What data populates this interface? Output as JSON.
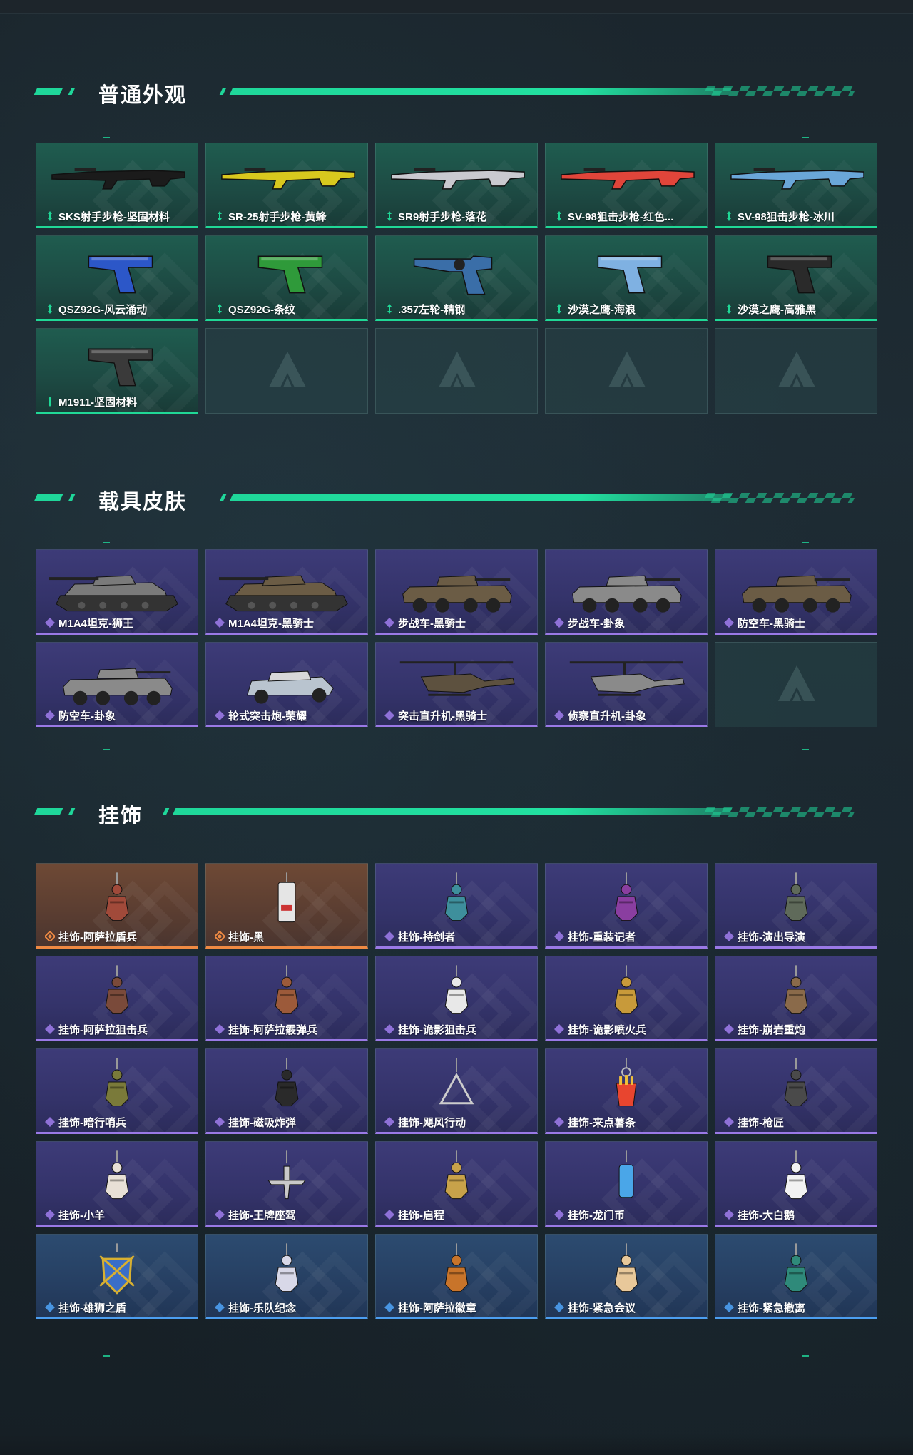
{
  "sections": {
    "skins": {
      "title": "普通外观",
      "items": [
        {
          "name": "SKS射手步枪-坚固材料",
          "rarity": "green",
          "icon": "rifle-icon",
          "color": "#1b1b1b"
        },
        {
          "name": "SR-25射手步枪-黄蜂",
          "rarity": "green",
          "icon": "rifle-icon",
          "color": "#d8c81e"
        },
        {
          "name": "SR9射手步枪-落花",
          "rarity": "green",
          "icon": "rifle-icon",
          "color": "#c9c9cf"
        },
        {
          "name": "SV-98狙击步枪-红色...",
          "rarity": "green",
          "icon": "rifle-icon",
          "color": "#e0453a"
        },
        {
          "name": "SV-98狙击步枪-冰川",
          "rarity": "green",
          "icon": "rifle-icon",
          "color": "#6aa6d8"
        },
        {
          "name": "QSZ92G-风云涌动",
          "rarity": "green",
          "icon": "pistol-icon",
          "color": "#2c57c8"
        },
        {
          "name": "QSZ92G-条纹",
          "rarity": "green",
          "icon": "pistol-icon",
          "color": "#2f9a3a"
        },
        {
          "name": ".357左轮-精钢",
          "rarity": "green",
          "icon": "revolver-icon",
          "color": "#3a6ea8"
        },
        {
          "name": "沙漠之鹰-海浪",
          "rarity": "green",
          "icon": "pistol-icon",
          "color": "#7fb1e2"
        },
        {
          "name": "沙漠之鹰-高雅黑",
          "rarity": "green",
          "icon": "pistol-icon",
          "color": "#2a2a2a"
        },
        {
          "name": "M1911-坚固材料",
          "rarity": "green",
          "icon": "pistol-icon",
          "color": "#3a3a3a"
        }
      ],
      "empty_slots": 4
    },
    "vehicles": {
      "title": "载具皮肤",
      "items": [
        {
          "name": "M1A4坦克-狮王",
          "rarity": "purple",
          "icon": "tank-icon",
          "color": "#7a7a7a"
        },
        {
          "name": "M1A4坦克-黑骑士",
          "rarity": "purple",
          "icon": "tank-icon",
          "color": "#6b5c45"
        },
        {
          "name": "步战车-黑骑士",
          "rarity": "purple",
          "icon": "apc-icon",
          "color": "#6b5c45"
        },
        {
          "name": "步战车-卦象",
          "rarity": "purple",
          "icon": "apc-icon",
          "color": "#8a8a8a"
        },
        {
          "name": "防空车-黑骑士",
          "rarity": "purple",
          "icon": "apc-icon",
          "color": "#6b5c45"
        },
        {
          "name": "防空车-卦象",
          "rarity": "purple",
          "icon": "apc-icon",
          "color": "#8a8a8a"
        },
        {
          "name": "轮式突击炮-荣耀",
          "rarity": "purple",
          "icon": "buggy-icon",
          "color": "#b9c4cf"
        },
        {
          "name": "突击直升机-黑骑士",
          "rarity": "purple",
          "icon": "helicopter-icon",
          "color": "#5d513f"
        },
        {
          "name": "侦察直升机-卦象",
          "rarity": "purple",
          "icon": "helicopter-icon",
          "color": "#8a8a8a"
        }
      ],
      "empty_slots": 1
    },
    "charms": {
      "title": "挂饰",
      "items": [
        {
          "name": "挂饰-阿萨拉盾兵",
          "rarity": "orange",
          "icon": "charm-figure-icon",
          "color": "#a14a3a"
        },
        {
          "name": "挂饰-黑",
          "rarity": "orange",
          "icon": "charm-tag-icon",
          "color": "#e5e5e5"
        },
        {
          "name": "挂饰-持剑者",
          "rarity": "purple",
          "icon": "charm-figure-icon",
          "color": "#3e8f9c"
        },
        {
          "name": "挂饰-重装记者",
          "rarity": "purple",
          "icon": "charm-figure-icon",
          "color": "#8a3ea0"
        },
        {
          "name": "挂饰-演出导演",
          "rarity": "purple",
          "icon": "charm-figure-icon",
          "color": "#5f6a5a"
        },
        {
          "name": "挂饰-阿萨拉狙击兵",
          "rarity": "purple",
          "icon": "charm-figure-icon",
          "color": "#7a4a3a"
        },
        {
          "name": "挂饰-阿萨拉霰弹兵",
          "rarity": "purple",
          "icon": "charm-figure-icon",
          "color": "#9c5a3a"
        },
        {
          "name": "挂饰-诡影狙击兵",
          "rarity": "purple",
          "icon": "charm-figure-icon",
          "color": "#e8e8e8"
        },
        {
          "name": "挂饰-诡影喷火兵",
          "rarity": "purple",
          "icon": "charm-figure-icon",
          "color": "#c89a3a"
        },
        {
          "name": "挂饰-崩岩重炮",
          "rarity": "purple",
          "icon": "charm-figure-icon",
          "color": "#8a6a4a"
        },
        {
          "name": "挂饰-暗行哨兵",
          "rarity": "purple",
          "icon": "charm-figure-icon",
          "color": "#7a7a3a"
        },
        {
          "name": "挂饰-磁吸炸弹",
          "rarity": "purple",
          "icon": "charm-bomb-icon",
          "color": "#2a2a2a"
        },
        {
          "name": "挂饰-飓风行动",
          "rarity": "purple",
          "icon": "charm-triangle-icon",
          "color": "#3a3a3a"
        },
        {
          "name": "挂饰-来点薯条",
          "rarity": "purple",
          "icon": "charm-fries-icon",
          "color": "#e8452f"
        },
        {
          "name": "挂饰-枪匠",
          "rarity": "purple",
          "icon": "charm-box-icon",
          "color": "#4a4a4a"
        },
        {
          "name": "挂饰-小羊",
          "rarity": "purple",
          "icon": "charm-sheep-icon",
          "color": "#e8e0d6"
        },
        {
          "name": "挂饰-王牌座驾",
          "rarity": "purple",
          "icon": "charm-plane-icon",
          "color": "#c9c9c9"
        },
        {
          "name": "挂饰-启程",
          "rarity": "purple",
          "icon": "charm-badge-icon",
          "color": "#c8a24a"
        },
        {
          "name": "挂饰-龙门币",
          "rarity": "purple",
          "icon": "charm-can-icon",
          "color": "#4aa6e8"
        },
        {
          "name": "挂饰-大白鹅",
          "rarity": "purple",
          "icon": "charm-goose-icon",
          "color": "#f2f2f2"
        },
        {
          "name": "挂饰-雄狮之盾",
          "rarity": "blue",
          "icon": "charm-shield-icon",
          "color": "#3a6ec8"
        },
        {
          "name": "挂饰-乐队纪念",
          "rarity": "blue",
          "icon": "charm-round-icon",
          "color": "#d8d8e8"
        },
        {
          "name": "挂饰-阿萨拉徽章",
          "rarity": "blue",
          "icon": "charm-badge-icon",
          "color": "#c8742a"
        },
        {
          "name": "挂饰-紧急会议",
          "rarity": "blue",
          "icon": "charm-figure-icon",
          "color": "#e8c89a"
        },
        {
          "name": "挂饰-紧急撤离",
          "rarity": "blue",
          "icon": "charm-box-icon",
          "color": "#2f8a7a"
        }
      ],
      "empty_slots": 0
    }
  },
  "rarity_colors": {
    "green": "#20d896",
    "purple": "#9a79e6",
    "orange": "#ef8a43",
    "blue": "#4c9ef0"
  },
  "accent": "#1fd79a"
}
